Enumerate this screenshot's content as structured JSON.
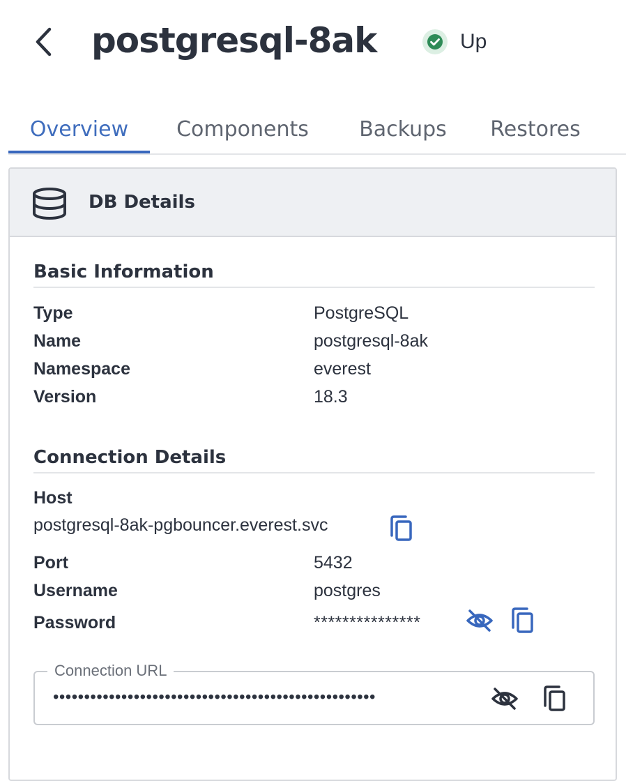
{
  "header": {
    "title": "postgresql-8ak",
    "status": {
      "label": "Up",
      "icon": "check-circle-icon",
      "color": "#2e8b57"
    }
  },
  "tabs": [
    {
      "label": "Overview",
      "active": true
    },
    {
      "label": "Components",
      "active": false
    },
    {
      "label": "Backups",
      "active": false
    },
    {
      "label": "Restores",
      "active": false
    }
  ],
  "db_details": {
    "title": "DB Details",
    "icon": "database-icon",
    "basic_information": {
      "title": "Basic Information",
      "rows": [
        {
          "label": "Type",
          "value": "PostgreSQL"
        },
        {
          "label": "Name",
          "value": "postgresql-8ak"
        },
        {
          "label": "Namespace",
          "value": "everest"
        },
        {
          "label": "Version",
          "value": "18.3"
        }
      ]
    },
    "connection_details": {
      "title": "Connection Details",
      "host": {
        "label": "Host",
        "value": "postgresql-8ak-pgbouncer.everest.svc"
      },
      "port": {
        "label": "Port",
        "value": "5432"
      },
      "username": {
        "label": "Username",
        "value": "postgres"
      },
      "password": {
        "label": "Password",
        "value": "***************"
      },
      "connection_url": {
        "label": "Connection URL",
        "value": "••••••••••••••••••••••••••••••••••••••••••••••••••••"
      }
    }
  },
  "colors": {
    "accent": "#3867bd",
    "text": "#2c323e",
    "muted": "#5f6570"
  }
}
